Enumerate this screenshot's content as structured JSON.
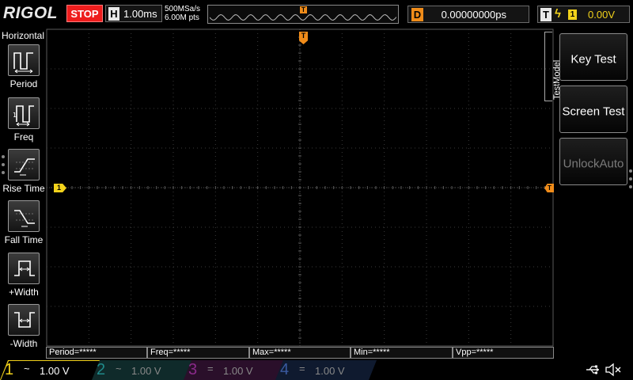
{
  "topbar": {
    "brand": "RIGOL",
    "run_state": "STOP",
    "horizontal": {
      "label": "H",
      "timebase": "1.00ms"
    },
    "sample_rate": "500MSa/s",
    "memory_depth": "6.00M pts",
    "trigger_position_marker": "T",
    "delay": {
      "label": "D",
      "value": "0.00000000ps"
    },
    "trigger": {
      "label": "T",
      "edge": "rising",
      "source": "1",
      "level": "0.00V"
    }
  },
  "left_menu": {
    "title": "Horizontal",
    "items": [
      {
        "label": "Period",
        "icon": "period-icon"
      },
      {
        "label": "Freq",
        "icon": "frequency-icon"
      },
      {
        "label": "Rise Time",
        "icon": "rise-time-icon"
      },
      {
        "label": "Fall Time",
        "icon": "fall-time-icon"
      },
      {
        "label": "+Width",
        "icon": "positive-width-icon"
      },
      {
        "label": "-Width",
        "icon": "negative-width-icon"
      }
    ]
  },
  "right_menu": {
    "title": "TestModel",
    "buttons": [
      {
        "label": "Key Test",
        "enabled": true
      },
      {
        "label": "Screen Test",
        "enabled": true
      },
      {
        "label": "UnlockAuto",
        "enabled": false
      }
    ]
  },
  "markers": {
    "channel1_level": "1",
    "trigger_top": "T",
    "trigger_level": "T"
  },
  "measurements": [
    "Period=*****",
    "Freq=*****",
    "Max=*****",
    "Min=*****",
    "Vpp=*****"
  ],
  "channels": [
    {
      "number": "1",
      "coupling": "~",
      "scale": "1.00 V",
      "active": true,
      "color": "#f2d21b"
    },
    {
      "number": "2",
      "coupling": "~",
      "scale": "1.00 V",
      "active": false,
      "color": "#1f8a8a"
    },
    {
      "number": "3",
      "coupling": "=",
      "scale": "1.00 V",
      "active": false,
      "color": "#8a2a8a"
    },
    {
      "number": "4",
      "coupling": "=",
      "scale": "1.00 V",
      "active": false,
      "color": "#2a4a8a"
    }
  ],
  "colors": {
    "stop": "#ee1d1d",
    "trigger": "#f08c1a",
    "channel1": "#f2d21b",
    "grid": "#3a3a3a"
  },
  "status_icons": [
    "usb-icon",
    "speaker-muted-icon"
  ]
}
